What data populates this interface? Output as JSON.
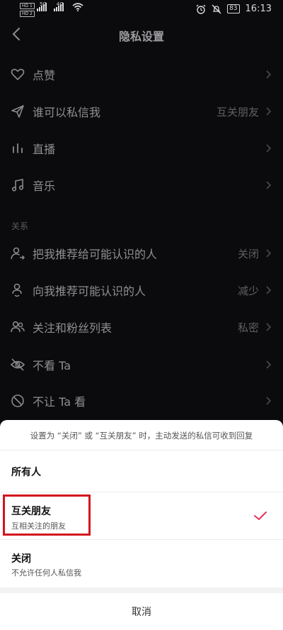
{
  "status_bar": {
    "sim1": "HD 1",
    "sim2": "HD 2",
    "net1": "5G",
    "net2": "4G",
    "battery": "83",
    "time": "16:13"
  },
  "header": {
    "title": "隐私设置"
  },
  "rows": [
    {
      "label": "点赞",
      "value": "",
      "icon": "heart-icon"
    },
    {
      "label": "谁可以私信我",
      "value": "互关朋友",
      "icon": "send-icon"
    },
    {
      "label": "直播",
      "value": "",
      "icon": "live-bars-icon"
    },
    {
      "label": "音乐",
      "value": "",
      "icon": "music-note-icon"
    },
    {
      "label": "把我推荐给可能认识的人",
      "value": "关闭",
      "icon": "person-share-icon"
    },
    {
      "label": "向我推荐可能认识的人",
      "value": "减少",
      "icon": "person-suggest-icon"
    },
    {
      "label": "关注和粉丝列表",
      "value": "私密",
      "icon": "people-icon"
    },
    {
      "label": "不看 Ta",
      "value": "",
      "icon": "eye-off-icon"
    },
    {
      "label": "不让 Ta 看",
      "value": "",
      "icon": "block-icon"
    }
  ],
  "section_label": "关系",
  "sheet": {
    "note": "设置为 “关闭” 或 “互关朋友” 时，主动发送的私信可收到回复",
    "options": [
      {
        "title": "所有人",
        "subtitle": ""
      },
      {
        "title": "互关朋友",
        "subtitle": "互相关注的朋友",
        "selected": true
      },
      {
        "title": "关闭",
        "subtitle": "不允许任何人私信我"
      }
    ],
    "cancel": "取消"
  },
  "colors": {
    "accent": "#e8305a",
    "highlight": "#d4141d"
  }
}
